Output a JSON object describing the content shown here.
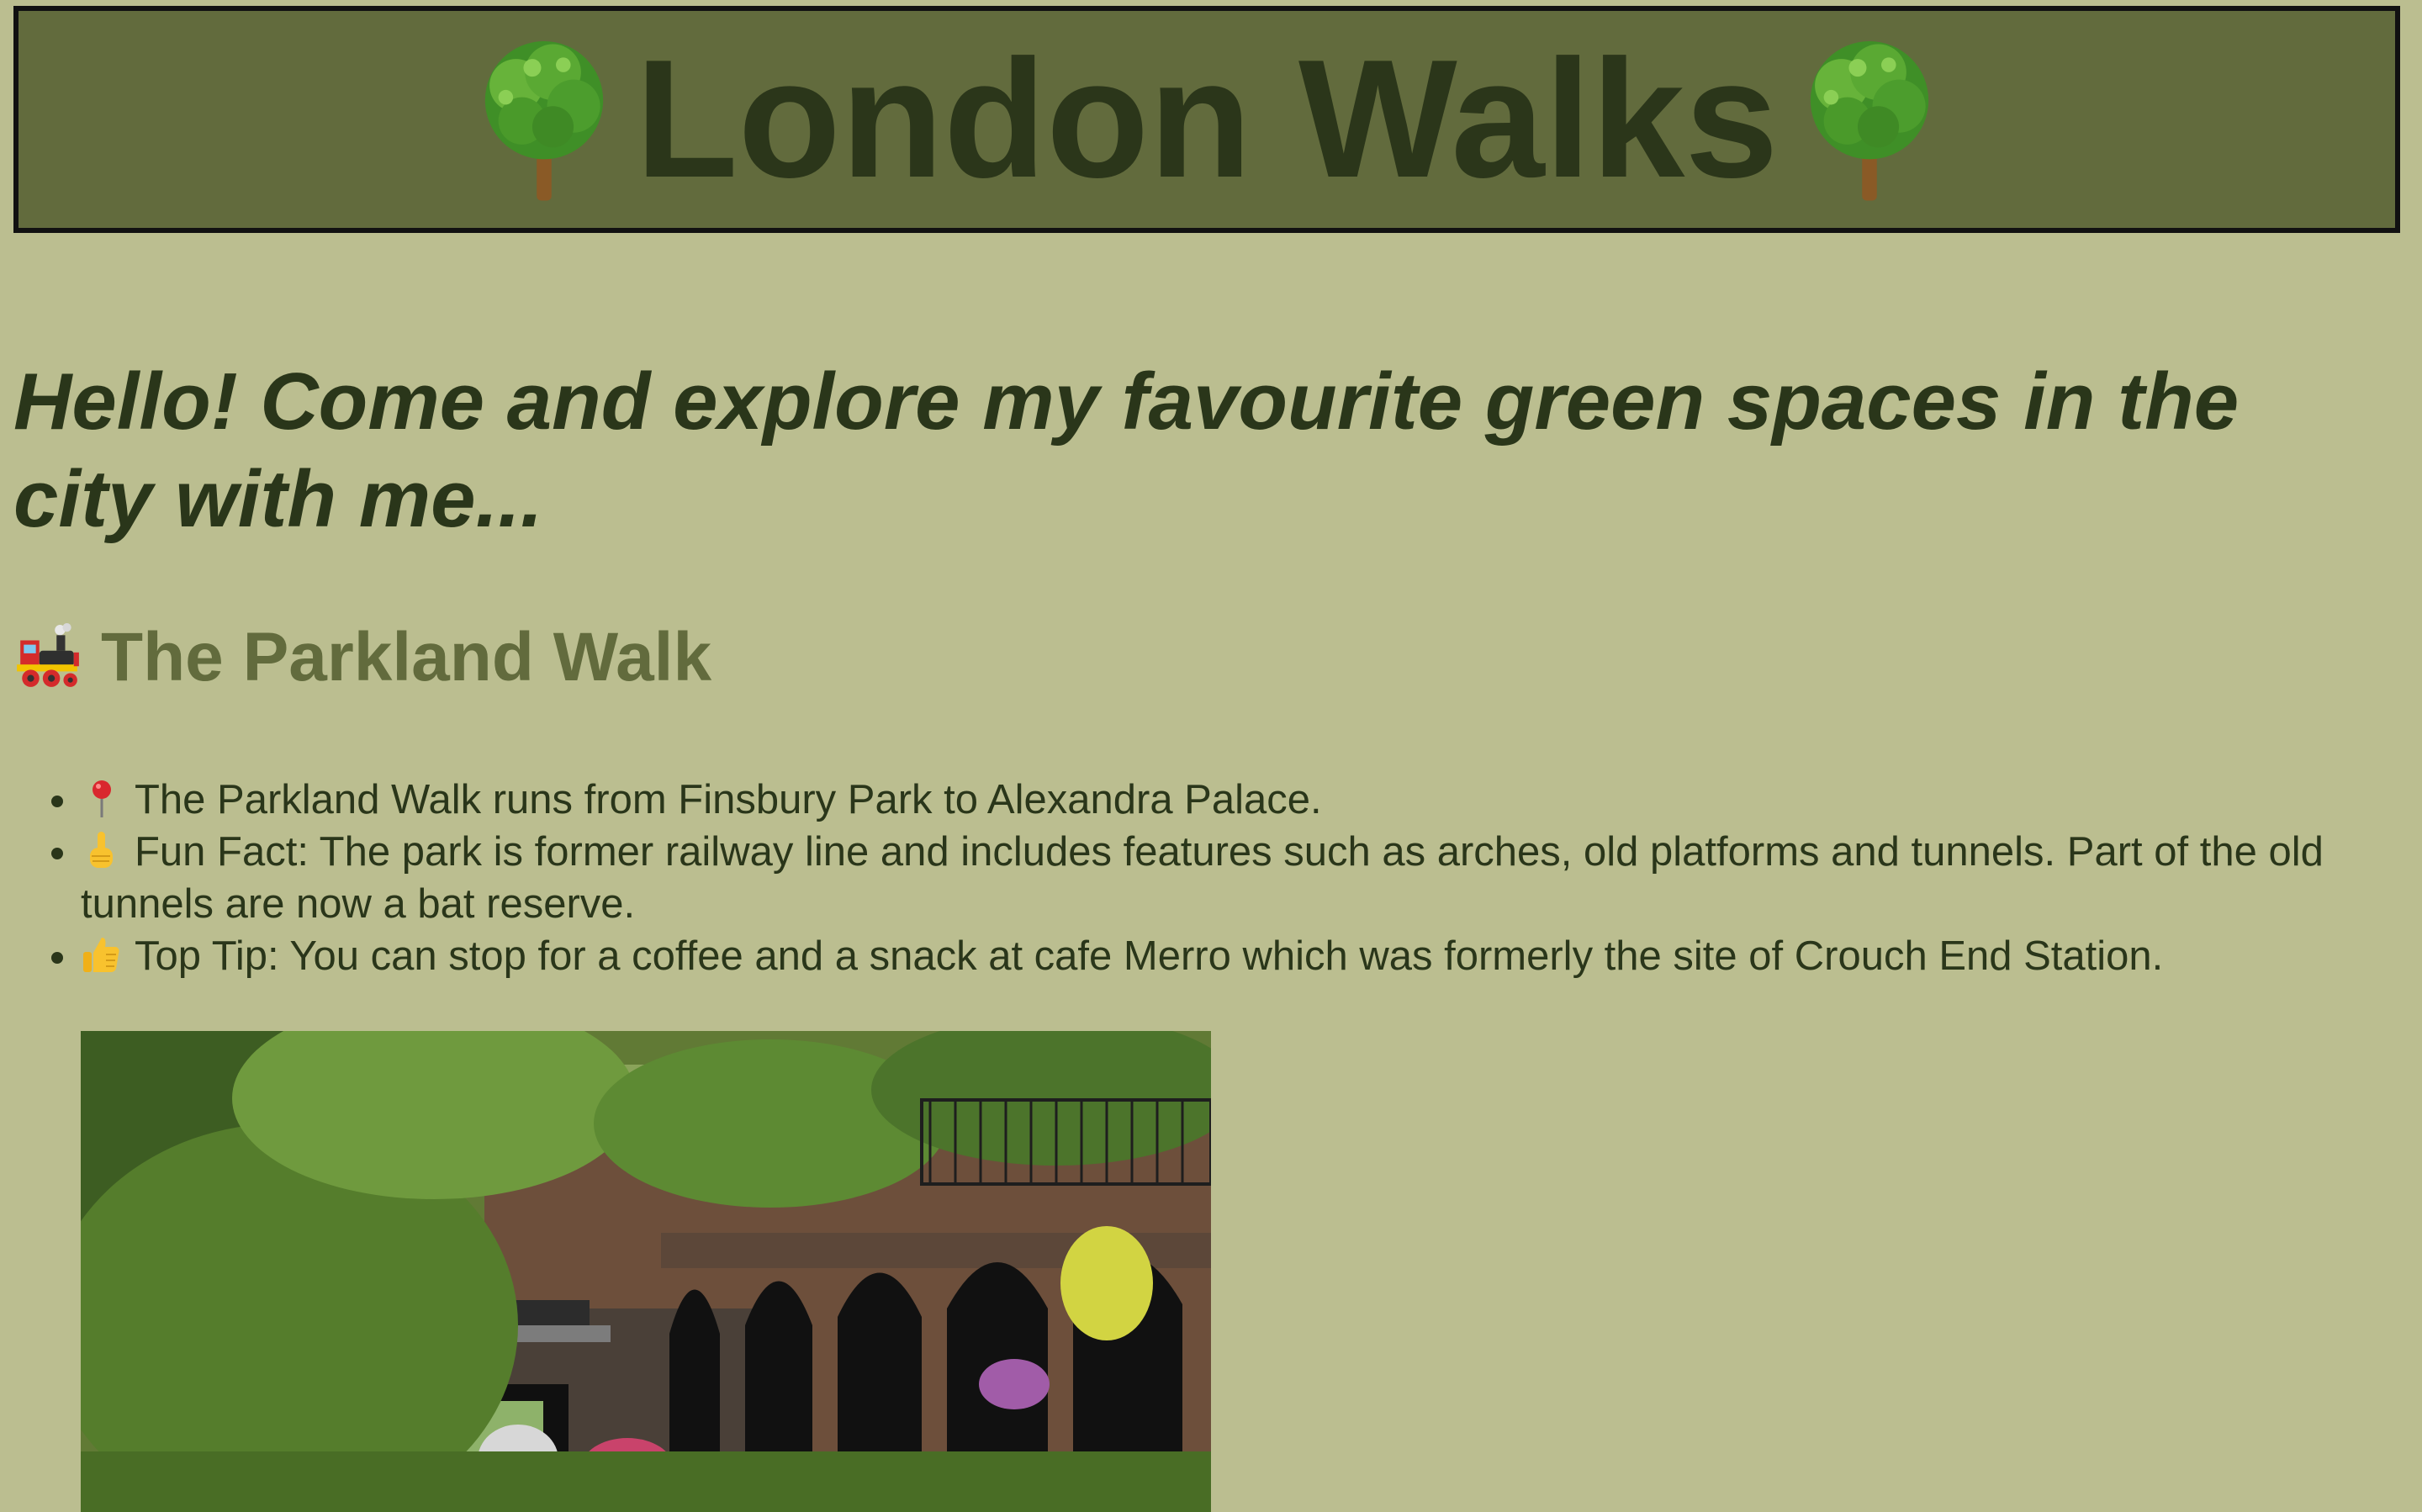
{
  "header": {
    "title": "London Walks",
    "left_icon": "deciduous-tree-icon",
    "right_icon": "deciduous-tree-icon"
  },
  "intro": {
    "text": "Hello! Come and explore my favourite green spaces in the city with me..."
  },
  "section": {
    "icon": "steam-locomotive-icon",
    "title": "The Parkland Walk",
    "items": [
      {
        "icon": "round-pushpin-icon",
        "text": "The Parkland Walk runs from Finsbury Park to Alexandra Palace."
      },
      {
        "icon": "index-pointing-up-icon",
        "text": "Fun Fact: The park is former railway line and includes features such as arches, old platforms and tunnels. Part of the old tunnels are now a bat reserve."
      },
      {
        "icon": "thumbs-up-icon",
        "text": "Top Tip: You can stop for a coffee and a snack at cafe Merro which was formerly the site of Crouch End Station."
      }
    ],
    "image": "parkland-walk-arches-photo"
  },
  "colors": {
    "page_background": "#bbbe90",
    "header_background": "#626b3d",
    "header_border": "#111111",
    "title_text": "#2b361a",
    "section_title": "#626b3d",
    "body_text": "#2a361a"
  }
}
